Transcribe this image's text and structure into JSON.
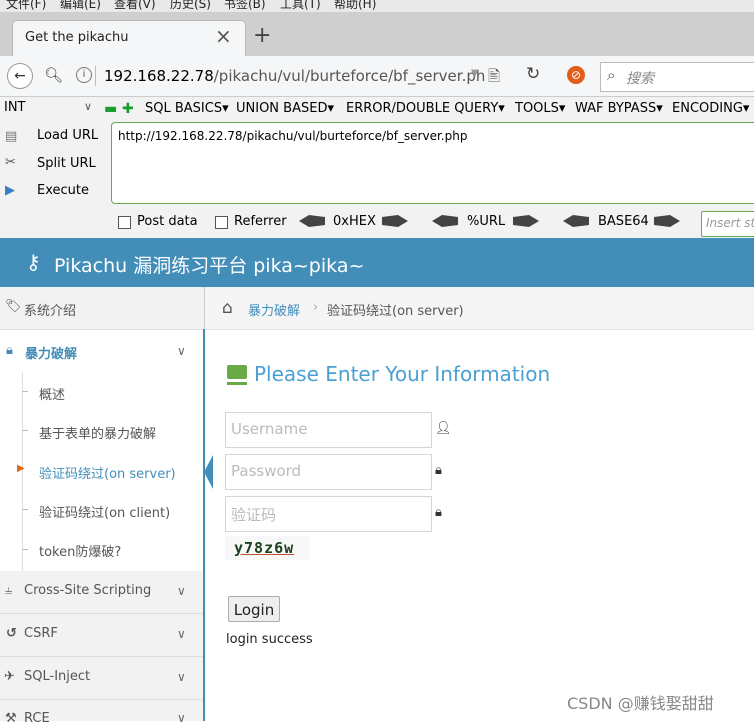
{
  "menubar": [
    "文件(F)",
    "编辑(E)",
    "查看(V)",
    "历史(S)",
    "书签(B)",
    "工具(T)",
    "帮助(H)"
  ],
  "tab": {
    "title": "Get the pikachu",
    "close": "×",
    "new_tab": "+"
  },
  "nav": {
    "url_host": "192.168.22.78",
    "url_path": "/pikachu/vul/burteforce/bf_server.ph",
    "search_placeholder": "搜索"
  },
  "hackbar": {
    "select_value": "INT",
    "menus": [
      "SQL BASICS▾",
      "UNION BASED▾",
      "ERROR/DOUBLE QUERY▾",
      "TOOLS▾",
      "WAF BYPASS▾",
      "ENCODING▾"
    ],
    "load_url": "Load URL",
    "split_url": "Split URL",
    "execute": "Execute",
    "textarea_value": "http://192.168.22.78/pikachu/vul/burteforce/bf_server.php",
    "post_data": "Post data",
    "referrer": "Referrer",
    "hex": "0xHEX",
    "url_enc": "%URL",
    "base64": "BASE64",
    "insert_placeholder": "Insert st"
  },
  "header": {
    "title": "Pikachu 漏洞练习平台 pika~pika~"
  },
  "sidebar": {
    "intro": "系统介绍",
    "bruteforce": "暴力破解",
    "sub_items": [
      "概述",
      "基于表单的暴力破解",
      "验证码绕过(on server)",
      "验证码绕过(on client)",
      "token防爆破?"
    ],
    "xss": "Cross-Site Scripting",
    "csrf": "CSRF",
    "sqli": "SQL-Inject",
    "rce": "RCE"
  },
  "breadcrumb": {
    "link": "暴力破解",
    "sep": "›",
    "current": "验证码绕过(on server)"
  },
  "form": {
    "heading": "Please Enter Your Information",
    "username_placeholder": "Username",
    "password_placeholder": "Password",
    "captcha_placeholder": "验证码",
    "captcha_text": "y78z6w",
    "login_button": "Login",
    "message": "login success"
  },
  "watermark": "CSDN @赚钱娶甜甜",
  "colors": {
    "header": "#438eb9",
    "accent_green": "#69aa46",
    "active_text": "#438eb9"
  }
}
